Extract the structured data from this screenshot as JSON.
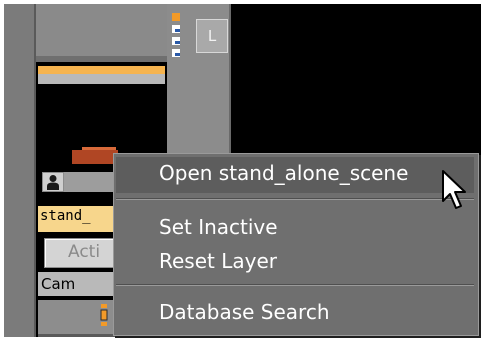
{
  "layer": {
    "name": "stand_",
    "active_button": "Acti",
    "cam_label": "Cam"
  },
  "panel": {
    "l_button_label": "L"
  },
  "context_menu": {
    "items": [
      {
        "label": "Open stand_alone_scene"
      },
      {
        "label": "Set Inactive"
      },
      {
        "label": "Reset Layer"
      },
      {
        "label": "Database Search"
      }
    ]
  },
  "colors": {
    "menu_bg": "#6f6f6f",
    "layer_name_bg": "#f7d68c",
    "accent_orange": "#f6b44f"
  }
}
